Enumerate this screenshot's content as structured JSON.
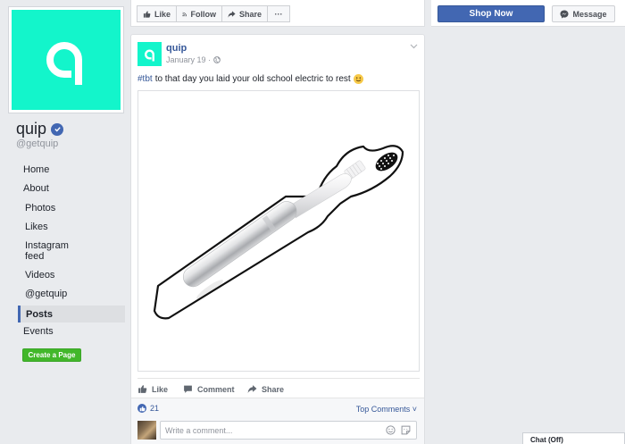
{
  "page": {
    "name": "quip",
    "handle": "@getquip",
    "brand_color": "#13f5cb",
    "accent_color": "#4267b2"
  },
  "sidebar": {
    "items": [
      {
        "label": "Home"
      },
      {
        "label": "About"
      },
      {
        "label": "Photos"
      },
      {
        "label": "Likes"
      },
      {
        "label": "Instagram feed"
      },
      {
        "label": "Videos"
      },
      {
        "label": "@getquip"
      },
      {
        "label": "Posts"
      },
      {
        "label": "Events"
      }
    ],
    "active": "Posts",
    "create_page_label": "Create a Page"
  },
  "actionbar": {
    "like_label": "Like",
    "follow_label": "Follow",
    "share_label": "Share",
    "more_label": "···",
    "shop_now_label": "Shop Now",
    "message_label": "Message"
  },
  "post": {
    "author": "quip",
    "date": "January 19 ·",
    "hashtag": "#tbt",
    "text": "to that day you laid your old school electric to rest",
    "like_label": "Like",
    "comment_label": "Comment",
    "share_label": "Share",
    "like_count": "21",
    "top_comments_label": "Top Comments ˅",
    "comment_placeholder": "Write a comment..."
  },
  "chat": {
    "label": "Chat (Off)"
  }
}
